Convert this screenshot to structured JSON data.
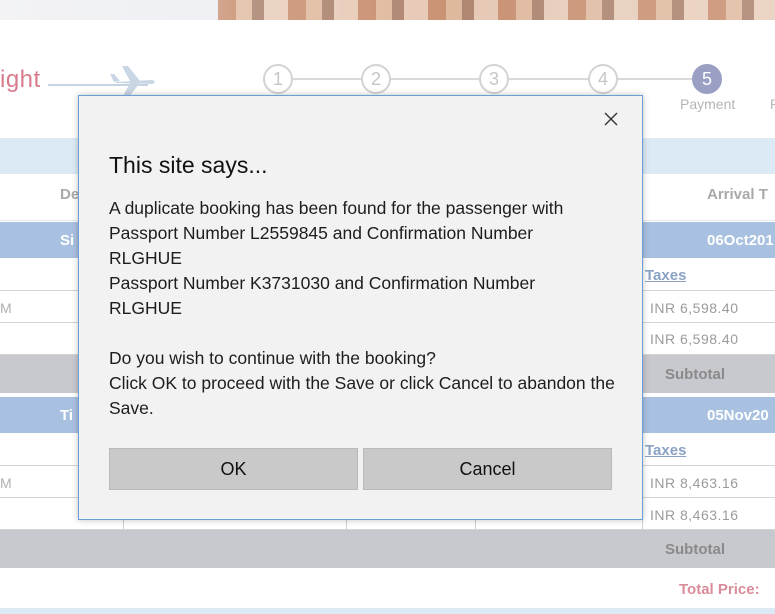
{
  "logo": {
    "text": "ight"
  },
  "steps": [
    {
      "number": "1",
      "label": ""
    },
    {
      "number": "2",
      "label": ""
    },
    {
      "number": "3",
      "label": ""
    },
    {
      "number": "4",
      "label": ""
    },
    {
      "number": "5",
      "label": "Payment"
    },
    {
      "number": "",
      "label": "P"
    }
  ],
  "table": {
    "headers": {
      "departure": "De",
      "arrival": "Arrival T"
    },
    "groups": [
      {
        "left": "Si",
        "right": "06Oct201",
        "taxes_label": "Taxes",
        "rows": [
          {
            "time": "M",
            "price": "INR 6,598.40"
          },
          {
            "time": "",
            "price": "INR 6,598.40"
          }
        ],
        "subtotal": "Subtotal"
      },
      {
        "left": "Ti",
        "right": "05Nov20",
        "taxes_label": "Taxes",
        "rows": [
          {
            "time": "M",
            "price": "INR 8,463.16"
          },
          {
            "time": "",
            "price": "INR 8,463.16"
          }
        ],
        "subtotal": "Subtotal"
      }
    ],
    "total_label": "Total Price:"
  },
  "dialog": {
    "title": "This site says...",
    "message": "A duplicate booking has been found for the passenger with\n Passport Number L2559845 and Confirmation Number\nRLGHUE\nPassport Number K3731030 and Confirmation Number\nRLGHUE\n\nDo you wish to continue with the booking?\nClick OK to proceed with the Save or click Cancel to abandon the Save.",
    "ok_label": "OK",
    "cancel_label": "Cancel",
    "close_icon": "close-icon"
  },
  "colors": {
    "accent_blue": "#a9c1e0",
    "dialog_border": "#6a9ed6",
    "logo_pink": "#d97b8c",
    "active_step": "#9aa0c4"
  }
}
